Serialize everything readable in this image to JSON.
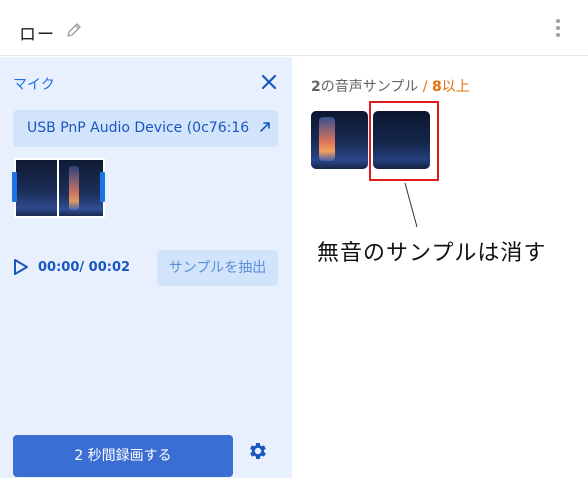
{
  "header": {
    "title": "ロー",
    "edit_icon": "pencil-icon",
    "menu_icon": "more-vert-icon"
  },
  "left_panel": {
    "mic_label": "マイク",
    "close_icon": "close-icon",
    "device_name": "USB PnP Audio Device (0c76:16",
    "device_icon": "external-arrow-icon",
    "time_display": "00:00/ 00:02",
    "play_icon": "play-icon",
    "extract_label": "サンプルを抽出",
    "record_label": "2 秒間録画する",
    "settings_icon": "gear-icon"
  },
  "right_panel": {
    "count_value": "2",
    "count_text": "の音声サンプル",
    "slash": " / ",
    "need_value": "8",
    "need_text": "以上",
    "annotation": "無音のサンプルは消す"
  },
  "colors": {
    "accent": "#1a73e8",
    "panel_bg": "#e8f0fe",
    "button_bg": "#3b6ed3",
    "warning": "#e8710a",
    "highlight": "#e01b1b"
  }
}
